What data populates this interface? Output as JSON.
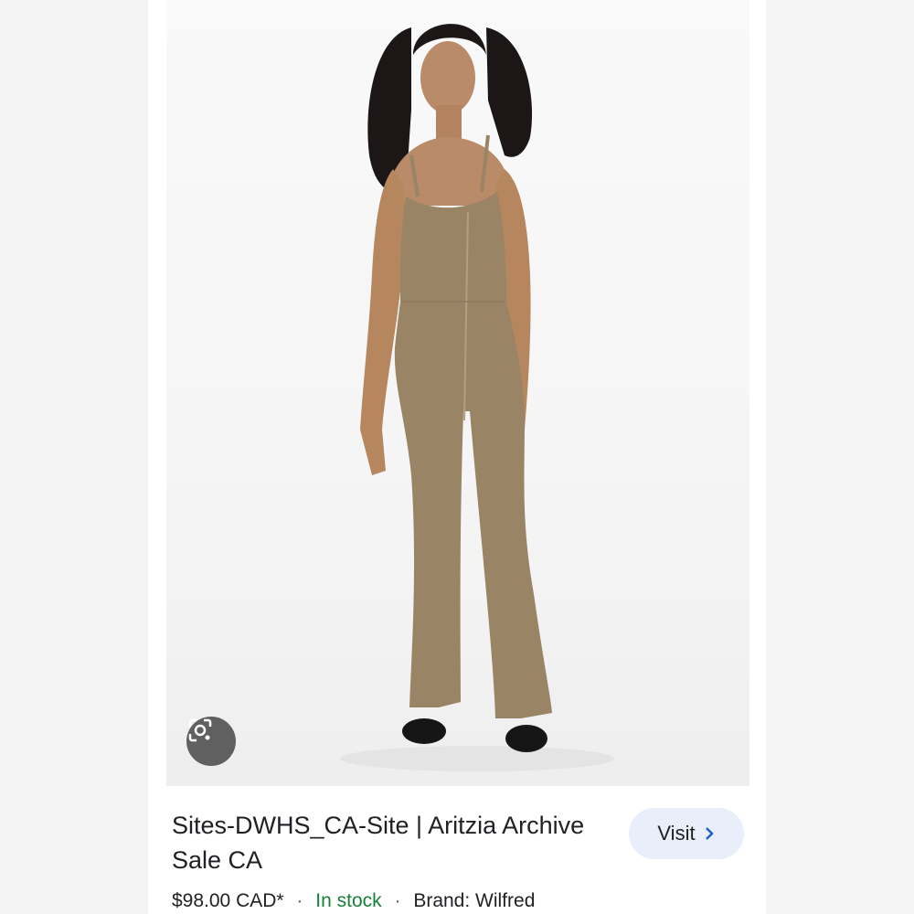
{
  "result": {
    "title": "Sites-DWHS_CA-Site | Aritzia Archive Sale CA",
    "price": "$98.00 CAD*",
    "stock": "In stock",
    "brand": "Brand: Wilfred",
    "separator": "·"
  },
  "visit_button": {
    "label": "Visit",
    "icon": "chevron-right-icon"
  },
  "lens_button": {
    "icon": "lens-search-icon"
  },
  "colors": {
    "garment": "#9a8466",
    "stock_green": "#188038",
    "visit_bg": "#e8eefa"
  }
}
